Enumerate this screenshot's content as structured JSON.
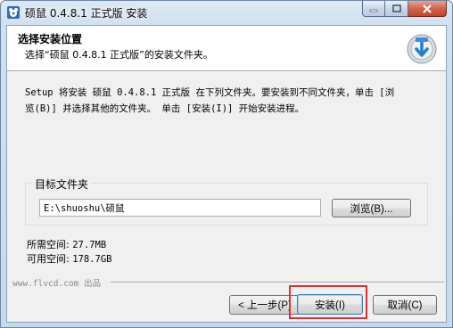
{
  "window": {
    "title": "硕鼠 0.4.8.1 正式版 安装"
  },
  "header": {
    "title": "选择安装位置",
    "subtitle": "选择“硕鼠 0.4.8.1 正式版”的安装文件夹。"
  },
  "description": {
    "line1": "Setup 将安装 硕鼠 0.4.8.1 正式版 在下列文件夹。要安装到不同文件夹，单击 [浏",
    "line2": "览(B)] 并选择其他的文件夹。 单击 [安装(I)] 开始安装进程。"
  },
  "destination": {
    "group_label": "目标文件夹",
    "path_value": "E:\\shuoshu\\硕鼠",
    "browse_label": "浏览(B)..."
  },
  "space": {
    "required_label": "所需空间:",
    "required_value": "27.7MB",
    "available_label": "可用空间:",
    "available_value": "178.7GB"
  },
  "branding": {
    "text": "www.flvcd.com 出品"
  },
  "buttons": {
    "back_label": "< 上一步(P)",
    "install_label": "安装(I)",
    "cancel_label": "取消(C)"
  },
  "colors": {
    "highlight": "#e03030",
    "title_bar": "#cfe0f1",
    "close_button": "#c2432a"
  },
  "icons": {
    "app": "mouse-app-icon",
    "header": "installer-disk-icon"
  }
}
